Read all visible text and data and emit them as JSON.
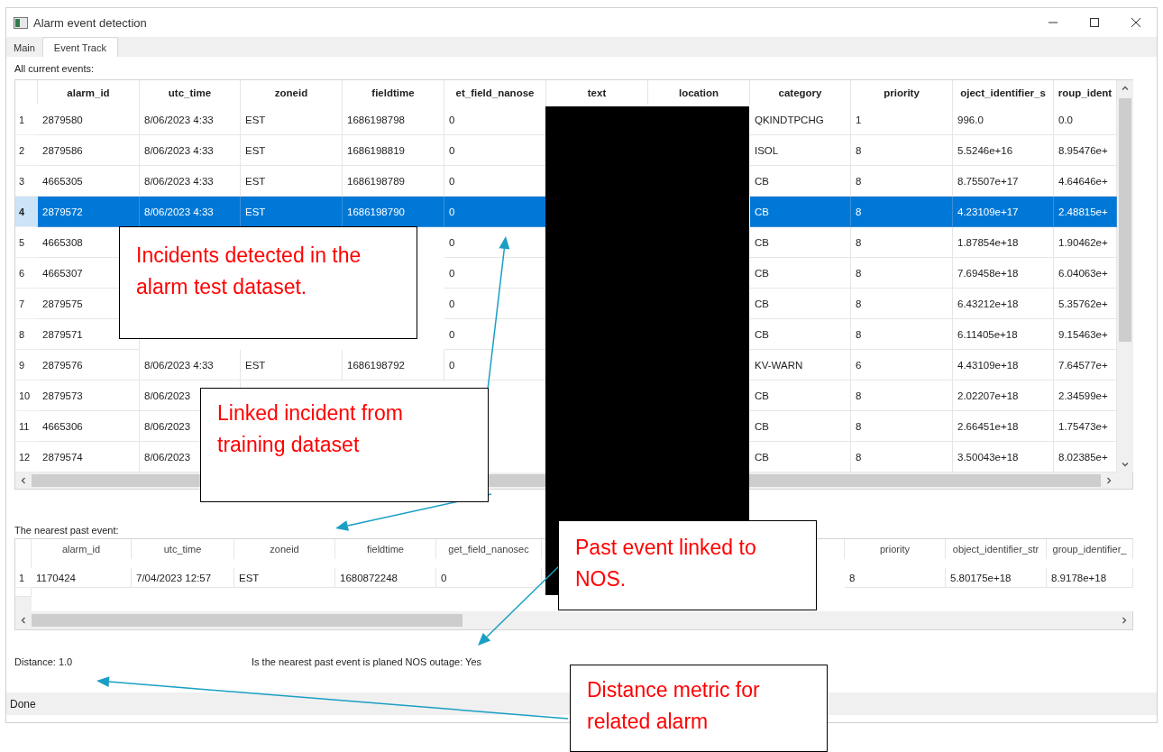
{
  "window": {
    "title": "Alarm event detection"
  },
  "tabs": [
    {
      "label": "Main",
      "selected": false
    },
    {
      "label": "Event Track",
      "selected": true
    }
  ],
  "current_events": {
    "label": "All current events:",
    "columns": [
      "alarm_id",
      "utc_time",
      "zoneid",
      "fieldtime",
      "et_field_nanose",
      "text",
      "location",
      "category",
      "priority",
      "oject_identifier_s",
      "roup_ident"
    ],
    "rows": [
      {
        "number": "1",
        "selected": false,
        "cells": [
          "2879580",
          "8/06/2023 4:33",
          "EST",
          "1686198798",
          "0",
          null,
          null,
          "QKINDTPCHG",
          "1",
          "996.0",
          "0.0"
        ]
      },
      {
        "number": "2",
        "selected": false,
        "cells": [
          "2879586",
          "8/06/2023 4:33",
          "EST",
          "1686198819",
          "0",
          null,
          null,
          "ISOL",
          "8",
          "5.5246e+16",
          "8.95476e+"
        ]
      },
      {
        "number": "3",
        "selected": false,
        "cells": [
          "4665305",
          "8/06/2023 4:33",
          "EST",
          "1686198789",
          "0",
          null,
          null,
          "CB",
          "8",
          "8.75507e+17",
          "4.64646e+"
        ]
      },
      {
        "number": "4",
        "selected": true,
        "cells": [
          "2879572",
          "8/06/2023 4:33",
          "EST",
          "1686198790",
          "0",
          null,
          null,
          "CB",
          "8",
          "4.23109e+17",
          "2.48815e+"
        ]
      },
      {
        "number": "5",
        "selected": false,
        "cells": [
          "4665308",
          null,
          null,
          null,
          "0",
          null,
          null,
          "CB",
          "8",
          "1.87854e+18",
          "1.90462e+"
        ]
      },
      {
        "number": "6",
        "selected": false,
        "cells": [
          "4665307",
          null,
          null,
          null,
          "0",
          null,
          null,
          "CB",
          "8",
          "7.69458e+18",
          "6.04063e+"
        ]
      },
      {
        "number": "7",
        "selected": false,
        "cells": [
          "2879575",
          null,
          null,
          null,
          "0",
          null,
          null,
          "CB",
          "8",
          "6.43212e+18",
          "5.35762e+"
        ]
      },
      {
        "number": "8",
        "selected": false,
        "cells": [
          "2879571",
          null,
          null,
          null,
          "0",
          null,
          null,
          "CB",
          "8",
          "6.11405e+18",
          "9.15463e+"
        ]
      },
      {
        "number": "9",
        "selected": false,
        "cells": [
          "2879576",
          "8/06/2023 4:33",
          "EST",
          "1686198792",
          "0",
          null,
          null,
          "KV-WARN",
          "6",
          "4.43109e+18",
          "7.64577e+"
        ]
      },
      {
        "number": "10",
        "selected": false,
        "cells": [
          "2879573",
          "8/06/2023",
          null,
          null,
          null,
          null,
          null,
          "CB",
          "8",
          "2.02207e+18",
          "2.34599e+"
        ]
      },
      {
        "number": "11",
        "selected": false,
        "cells": [
          "4665306",
          "8/06/2023",
          null,
          null,
          null,
          null,
          null,
          "CB",
          "8",
          "2.66451e+18",
          "1.75473e+"
        ]
      },
      {
        "number": "12",
        "selected": false,
        "cells": [
          "2879574",
          "8/06/2023",
          null,
          null,
          null,
          null,
          null,
          "CB",
          "8",
          "3.50043e+18",
          "8.02385e+"
        ]
      }
    ]
  },
  "nearest_past_event": {
    "label": "The nearest past event:",
    "columns": [
      "alarm_id",
      "utc_time",
      "zoneid",
      "fieldtime",
      "get_field_nanosec",
      null,
      null,
      null,
      "priority",
      "object_identifier_str",
      "group_identifier_"
    ],
    "rows": [
      {
        "number": "1",
        "selected": false,
        "cells": [
          "1170424",
          "7/04/2023 12:57",
          "EST",
          "1680872248",
          "0",
          null,
          null,
          null,
          "8",
          "5.80175e+18",
          "8.9178e+18"
        ]
      }
    ]
  },
  "distance": "Distance: 1.0",
  "planned_outage": "Is the nearest past event is planed NOS outage: Yes",
  "status_bar": "Done",
  "annotations": [
    {
      "text": "Incidents detected in the alarm test dataset."
    },
    {
      "text": "Linked incident from training dataset"
    },
    {
      "text": "Past event linked to NOS."
    },
    {
      "text": "Distance metric for related alarm"
    }
  ]
}
